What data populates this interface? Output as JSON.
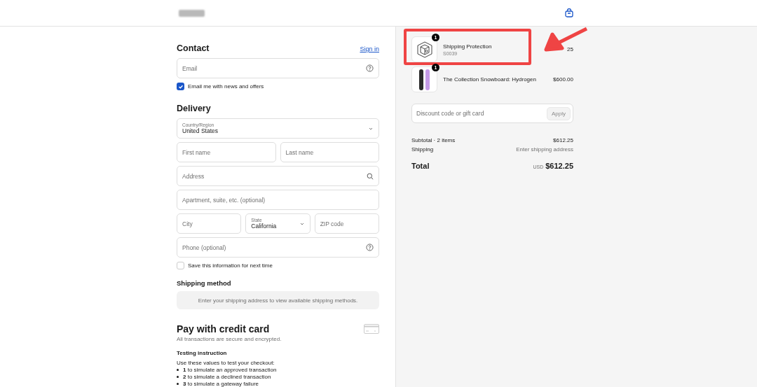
{
  "contact": {
    "title": "Contact",
    "sign_in": "Sign in",
    "email": {
      "placeholder": "Email"
    },
    "newsletter": {
      "label": "Email me with news and offers",
      "checked": true
    }
  },
  "delivery": {
    "title": "Delivery",
    "fields": [
      {
        "kind": "select",
        "label": "Country/Region",
        "value": "United States"
      },
      {
        "kind": "row",
        "fields": [
          {
            "kind": "text",
            "placeholder": "First name"
          },
          {
            "kind": "text",
            "placeholder": "Last name"
          }
        ]
      },
      {
        "kind": "search",
        "placeholder": "Address"
      },
      {
        "kind": "text",
        "placeholder": "Apartment, suite, etc. (optional)"
      },
      {
        "kind": "row",
        "fields": [
          {
            "kind": "text",
            "placeholder": "City"
          },
          {
            "kind": "select",
            "label": "State",
            "value": "California"
          },
          {
            "kind": "text",
            "placeholder": "ZIP code"
          }
        ]
      },
      {
        "kind": "help",
        "placeholder": "Phone (optional)"
      }
    ],
    "save": {
      "label": "Save this information for next time",
      "checked": false
    }
  },
  "shipping_method": {
    "title": "Shipping method",
    "notice": "Enter your shipping address to view available shipping methods."
  },
  "payment": {
    "title": "Pay with credit card",
    "subtitle": "All transactions are secure and encrypted.",
    "testing_title": "Testing instruction",
    "testing_intro": "Use these values to test your checkout:",
    "items": [
      "**1** to simulate an approved transaction",
      "**2** to simulate a declined transaction",
      "**3** to simulate a gateway failure"
    ]
  },
  "order": {
    "items": [
      {
        "kind": "box",
        "name": "Shipping Protection",
        "sku": "S0039",
        "quantity": "1",
        "price": "25",
        "highlighted": true
      },
      {
        "kind": "board",
        "name": "The Collection Snowboard: Hydrogen",
        "quantity": "1",
        "price": "$600.00",
        "highlighted": false
      }
    ],
    "discount": {
      "placeholder": "Discount code or gift card",
      "button": "Apply"
    },
    "summary": [
      {
        "label": "Subtotal · 2 items",
        "value": "$612.25"
      },
      {
        "label": "Shipping",
        "value": "Enter shipping address"
      }
    ],
    "total": {
      "label": "Total",
      "currency": "USD",
      "value": "$612.25"
    }
  }
}
